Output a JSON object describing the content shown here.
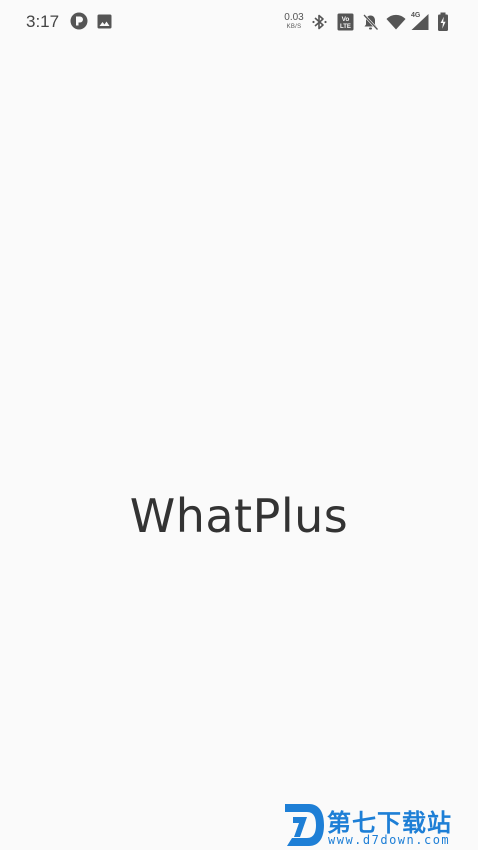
{
  "status_bar": {
    "time": "3:17",
    "net_speed_value": "0.03",
    "net_speed_unit": "KB/S",
    "volte_label": "Vo LTE",
    "network_type": "4G",
    "icons": [
      "app-notification-icon",
      "image-notification-icon",
      "bluetooth-icon",
      "volte-icon",
      "mute-notifications-icon",
      "wifi-icon",
      "cell-signal-icon",
      "battery-charging-icon"
    ]
  },
  "splash": {
    "app_name": "WhatPlus"
  },
  "watermark": {
    "site_name": "第七下载站",
    "url": "www.d7down.com",
    "color": "#1e7fd6"
  },
  "colors": {
    "background": "#fafafa",
    "text": "#333333",
    "status_icons": "#555555",
    "brand_blue": "#1e7fd6"
  }
}
